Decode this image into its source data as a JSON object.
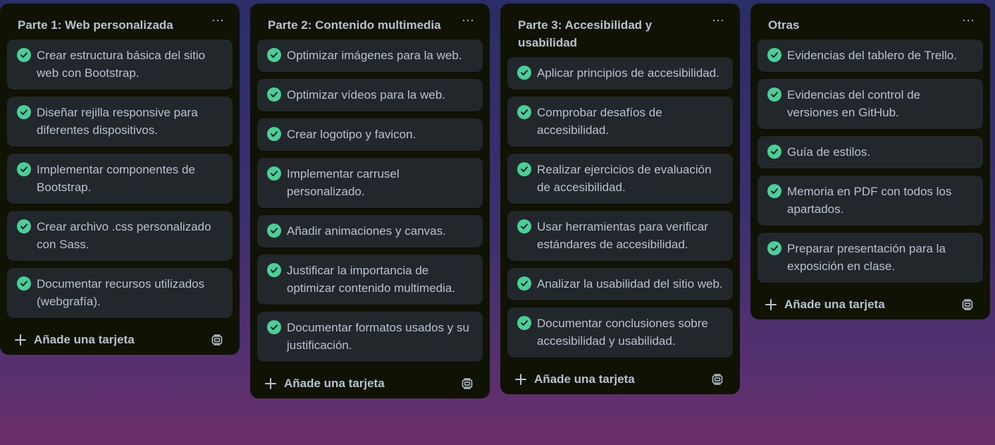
{
  "board": {
    "add_card_label": "Añade una tarjeta",
    "check_color": "#4bce97",
    "lists": [
      {
        "title": "Parte 1: Web personalizada",
        "cards": [
          "Crear estructura básica del sitio web con Bootstrap.",
          "Diseñar rejilla responsive para diferentes dispositivos.",
          "Implementar componentes de Bootstrap.",
          "Crear archivo .css personalizado con Sass.",
          "Documentar recursos utilizados (webgrafía)."
        ]
      },
      {
        "title": "Parte 2: Contenido multimedia",
        "cards": [
          "Optimizar imágenes para la web.",
          "Optimizar vídeos para la web.",
          "Crear logotipo y favicon.",
          "Implementar carrusel personalizado.",
          "Añadir animaciones y canvas.",
          "Justificar la importancia de optimizar contenido multimedia.",
          "Documentar formatos usados y su justificación."
        ]
      },
      {
        "title": "Parte 3: Accesibilidad y usabilidad",
        "cards": [
          "Aplicar principios de accesibilidad.",
          "Comprobar desafíos de accesibilidad.",
          "Realizar ejercicios de evaluación de accesibilidad.",
          "Usar herramientas para verificar estándares de accesibilidad.",
          "Analizar la usabilidad del sitio web.",
          "Documentar conclusiones sobre accesibilidad y usabilidad."
        ]
      },
      {
        "title": "Otras",
        "cards": [
          "Evidencias del tablero de Trello.",
          "Evidencias del control de versiones en GitHub.",
          "Guía de estilos.",
          "Memoria en PDF con todos los apartados.",
          "Preparar presentación para la exposición en clase."
        ]
      }
    ]
  }
}
